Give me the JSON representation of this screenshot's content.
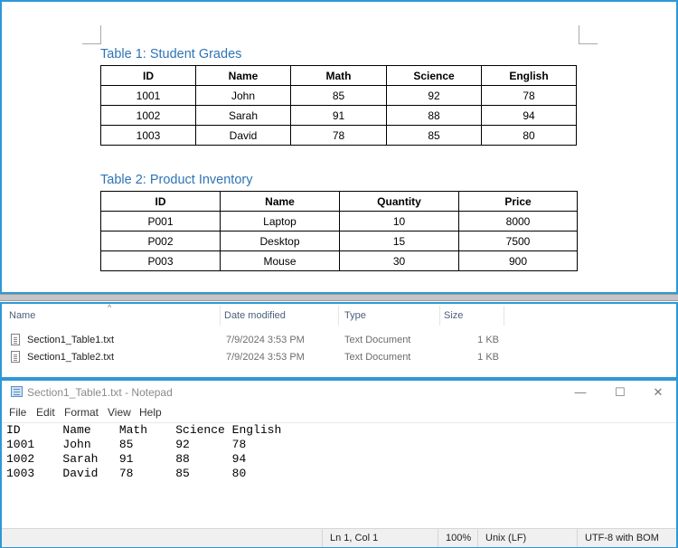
{
  "document": {
    "table1": {
      "caption": "Table 1: Student Grades",
      "headers": [
        "ID",
        "Name",
        "Math",
        "Science",
        "English"
      ],
      "rows": [
        [
          "1001",
          "John",
          "85",
          "92",
          "78"
        ],
        [
          "1002",
          "Sarah",
          "91",
          "88",
          "94"
        ],
        [
          "1003",
          "David",
          "78",
          "85",
          "80"
        ]
      ]
    },
    "table2": {
      "caption": "Table 2: Product Inventory",
      "headers": [
        "ID",
        "Name",
        "Quantity",
        "Price"
      ],
      "rows": [
        [
          "P001",
          "Laptop",
          "10",
          "8000"
        ],
        [
          "P002",
          "Desktop",
          "15",
          "7500"
        ],
        [
          "P003",
          "Mouse",
          "30",
          "900"
        ]
      ]
    }
  },
  "explorer": {
    "columns": {
      "name": "Name",
      "date_modified": "Date modified",
      "type": "Type",
      "size": "Size"
    },
    "files": [
      {
        "name": "Section1_Table1.txt",
        "date": "7/9/2024 3:53 PM",
        "type": "Text Document",
        "size": "1 KB"
      },
      {
        "name": "Section1_Table2.txt",
        "date": "7/9/2024 3:53 PM",
        "type": "Text Document",
        "size": "1 KB"
      }
    ]
  },
  "notepad": {
    "title": "Section1_Table1.txt - Notepad",
    "window_buttons": {
      "minimize": "—",
      "maximize": "☐",
      "close": "✕"
    },
    "menu": [
      "File",
      "Edit",
      "Format",
      "View",
      "Help"
    ],
    "content": "ID      Name    Math    Science English\n1001    John    85      92      78\n1002    Sarah   91      88      94\n1003    David   78      85      80",
    "status": {
      "position": "Ln 1, Col 1",
      "zoom": "100%",
      "line_ending": "Unix (LF)",
      "encoding": "UTF-8 with BOM"
    }
  },
  "colors": {
    "accent_border": "#2f98d6",
    "caption": "#2e74b5"
  }
}
